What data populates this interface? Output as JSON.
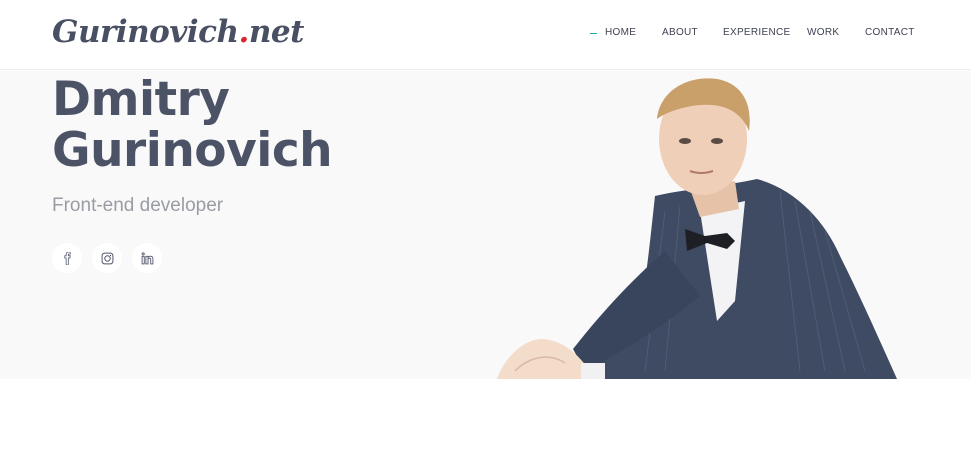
{
  "header": {
    "logo": {
      "text_main": "Gurinovich",
      "text_dot": ".",
      "text_tld": "net"
    },
    "nav": [
      {
        "label": "HOME",
        "active": true
      },
      {
        "label": "ABOUT",
        "active": false
      },
      {
        "label": "EXPERIENCE",
        "active": false
      },
      {
        "label": "WORK",
        "active": false
      },
      {
        "label": "CONTACT",
        "active": false
      }
    ]
  },
  "hero": {
    "name_line1": "Dmitry",
    "name_line2": "Gurinovich",
    "role": "Front-end developer",
    "socials": [
      {
        "icon": "facebook-icon"
      },
      {
        "icon": "instagram-icon"
      },
      {
        "icon": "linkedin-icon"
      }
    ]
  },
  "colors": {
    "accent": "#1aa9a4",
    "logo_dot": "#d8262c",
    "heading": "#4d5367",
    "subtitle": "#9a9ca3",
    "hero_bg": "#f9f9fa"
  }
}
